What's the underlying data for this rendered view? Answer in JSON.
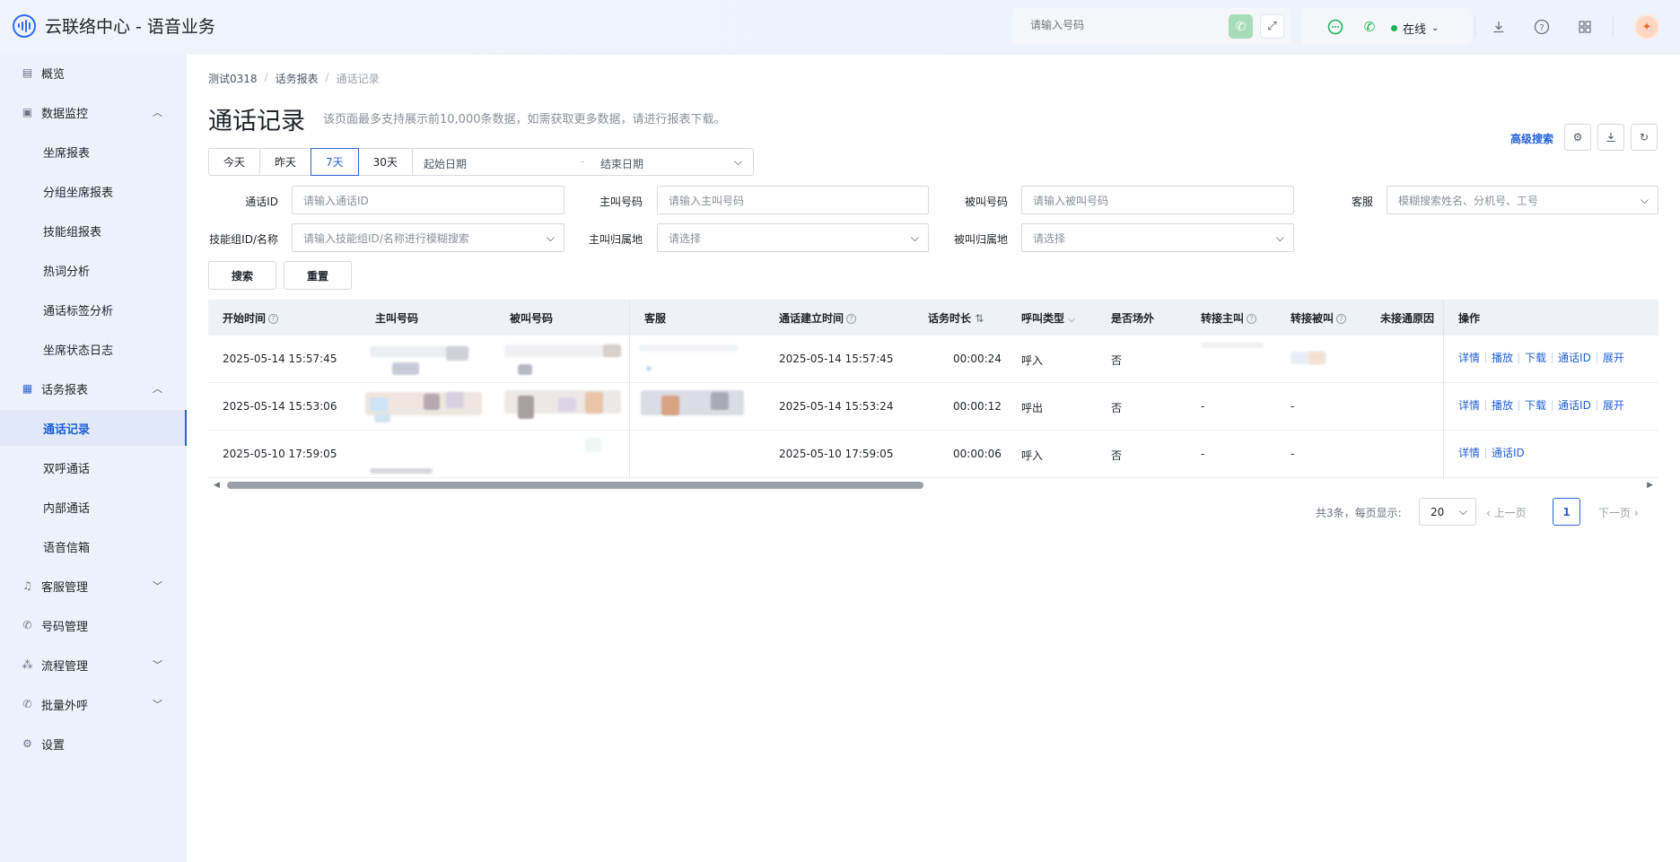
{
  "header": {
    "app_title": "云联络中心 - 语音业务",
    "dial_placeholder": "请输入号码",
    "status": "在线"
  },
  "sidebar": {
    "items": [
      {
        "label": "概览",
        "icon": "overview-icon"
      },
      {
        "label": "数据监控",
        "icon": "monitor-icon",
        "expanded": true
      },
      {
        "label": "坐席报表"
      },
      {
        "label": "分组坐席报表"
      },
      {
        "label": "技能组报表"
      },
      {
        "label": "热词分析"
      },
      {
        "label": "通话标签分析"
      },
      {
        "label": "坐席状态日志"
      },
      {
        "label": "话务报表",
        "icon": "report-icon",
        "expanded": true
      },
      {
        "label": "通话记录",
        "active": true
      },
      {
        "label": "双呼通话"
      },
      {
        "label": "内部通话"
      },
      {
        "label": "语音信箱"
      },
      {
        "label": "客服管理",
        "icon": "headset-icon",
        "expanded": false
      },
      {
        "label": "号码管理",
        "icon": "phone-icon"
      },
      {
        "label": "流程管理",
        "icon": "flow-icon",
        "expanded": false
      },
      {
        "label": "批量外呼",
        "icon": "batch-call-icon",
        "expanded": false
      },
      {
        "label": "设置",
        "icon": "settings-icon"
      }
    ]
  },
  "breadcrumb": [
    "测试0318",
    "话务报表",
    "通话记录"
  ],
  "page": {
    "title": "通话记录",
    "hint": "该页面最多支持展示前10,000条数据，如需获取更多数据，请进行报表下载。",
    "advanced_search": "高级搜索"
  },
  "range": {
    "buttons": [
      "今天",
      "昨天",
      "7天",
      "30天"
    ],
    "active": "7天",
    "start_placeholder": "起始日期",
    "separator": "-",
    "end_placeholder": "结束日期"
  },
  "filters": {
    "call_id_label": "通话ID",
    "call_id_placeholder": "请输入通话ID",
    "caller_label": "主叫号码",
    "caller_placeholder": "请输入主叫号码",
    "callee_label": "被叫号码",
    "callee_placeholder": "请输入被叫号码",
    "agent_label": "客服",
    "agent_placeholder": "模糊搜索姓名、分机号、工号",
    "skill_label": "技能组ID/名称",
    "skill_placeholder": "请输入技能组ID/名称进行模糊搜索",
    "caller_region_label": "主叫归属地",
    "caller_region_placeholder": "请选择",
    "callee_region_label": "被叫归属地",
    "callee_region_placeholder": "请选择",
    "search_button": "搜索",
    "reset_button": "重置"
  },
  "table": {
    "columns": [
      "开始时间",
      "主叫号码",
      "被叫号码",
      "客服",
      "通话建立时间",
      "话务时长",
      "呼叫类型",
      "是否场外",
      "转接主叫",
      "转接被叫",
      "未接通原因",
      "操作"
    ],
    "rows": [
      {
        "start": "2025-05-14 15:57:45",
        "established": "2025-05-14 15:57:45",
        "duration": "00:00:24",
        "type": "呼入",
        "offsite": "否",
        "transfer_caller": "",
        "transfer_callee": "",
        "ops": [
          "详情",
          "播放",
          "下载",
          "通话ID",
          "展开"
        ]
      },
      {
        "start": "2025-05-14 15:53:06",
        "established": "2025-05-14 15:53:24",
        "duration": "00:00:12",
        "type": "呼出",
        "offsite": "否",
        "transfer_caller": "-",
        "transfer_callee": "-",
        "ops": [
          "详情",
          "播放",
          "下载",
          "通话ID",
          "展开"
        ]
      },
      {
        "start": "2025-05-10 17:59:05",
        "established": "2025-05-10 17:59:05",
        "duration": "00:00:06",
        "type": "呼入",
        "offsite": "否",
        "transfer_caller": "-",
        "transfer_callee": "-",
        "ops": [
          "详情",
          "通话ID"
        ]
      }
    ]
  },
  "pagination": {
    "summary": "共3条，每页显示:",
    "page_size": "20",
    "prev": "上一页",
    "current": "1",
    "next": "下一页"
  },
  "colors": {
    "accent": "#2a64d6",
    "online": "#1db356"
  }
}
